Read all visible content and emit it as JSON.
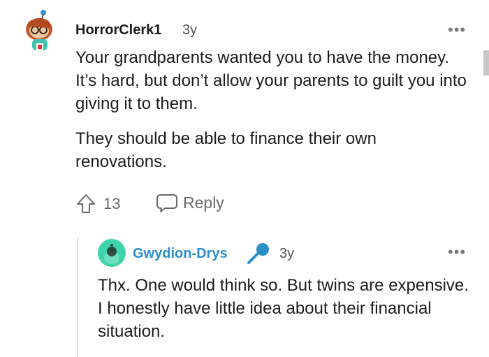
{
  "comment": {
    "username": "HorrorClerk1",
    "age": "3y",
    "paragraphs": [
      "Your grandparents wanted you to have the money. It’s hard, but don’t allow your parents to guilt you into giving it to them.",
      "They should be able to finance their own renovations."
    ],
    "upvotes": "13",
    "reply_label": "Reply",
    "more_label": "•••"
  },
  "reply": {
    "username": "Gwydion-Drys",
    "age": "3y",
    "text": "Thx. One would think so. But twins are expensive. I honestly have little idea about their financial situation.",
    "more_label": "•••"
  },
  "colors": {
    "reply_username": "#2a8fc9",
    "mic_badge": "#2a8fc9",
    "reply_avatar_bg": "#3fd3a9"
  },
  "icons": [
    "snoo-avatar-icon",
    "snoo-avatar-icon",
    "microphone-icon",
    "upvote-icon",
    "comment-bubble-icon",
    "more-options-icon"
  ]
}
